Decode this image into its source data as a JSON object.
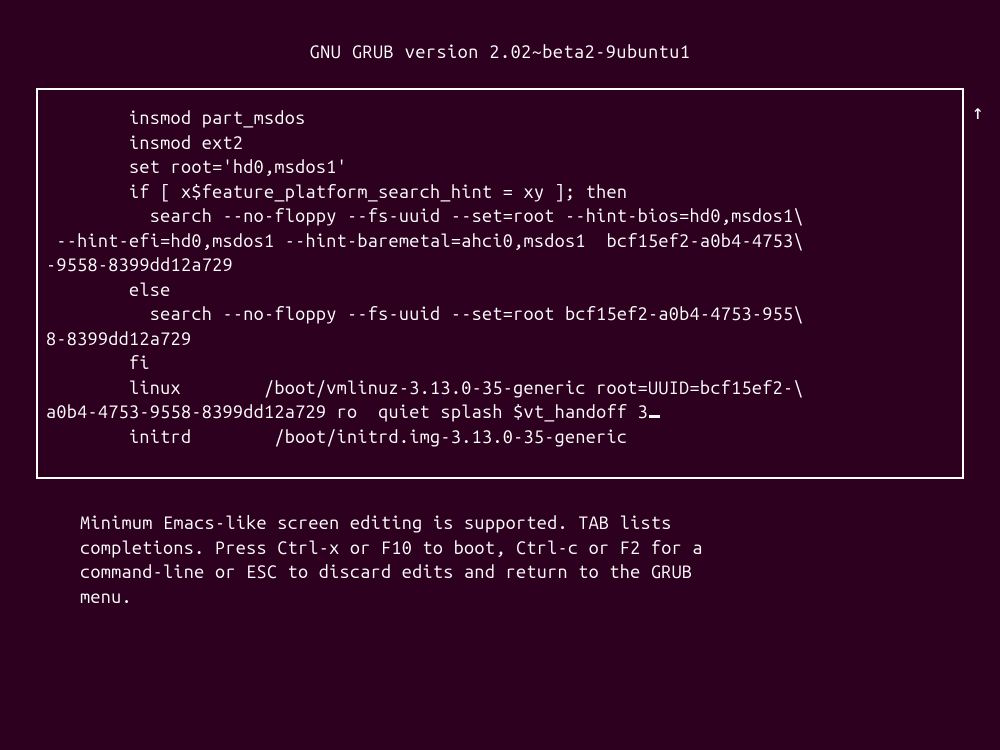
{
  "header": {
    "title": "GNU GRUB  version 2.02~beta2-9ubuntu1"
  },
  "editor": {
    "lines": [
      "        insmod part_msdos",
      "        insmod ext2",
      "        set root='hd0,msdos1'",
      "        if [ x$feature_platform_search_hint = xy ]; then",
      "          search --no-floppy --fs-uuid --set=root --hint-bios=hd0,msdos1\\",
      " --hint-efi=hd0,msdos1 --hint-baremetal=ahci0,msdos1  bcf15ef2-a0b4-4753\\",
      "-9558-8399dd12a729",
      "        else",
      "          search --no-floppy --fs-uuid --set=root bcf15ef2-a0b4-4753-955\\",
      "8-8399dd12a729",
      "        fi",
      "        linux        /boot/vmlinuz-3.13.0-35-generic root=UUID=bcf15ef2-\\",
      "a0b4-4753-9558-8399dd12a729 ro  quiet splash $vt_handoff 3",
      "        initrd        /boot/initrd.img-3.13.0-35-generic"
    ],
    "cursor_line": 12,
    "scroll_indicator": "↑"
  },
  "help": {
    "text": "Minimum Emacs-like screen editing is supported. TAB lists\ncompletions. Press Ctrl-x or F10 to boot, Ctrl-c or F2 for a\ncommand-line or ESC to discard edits and return to the GRUB\nmenu."
  }
}
